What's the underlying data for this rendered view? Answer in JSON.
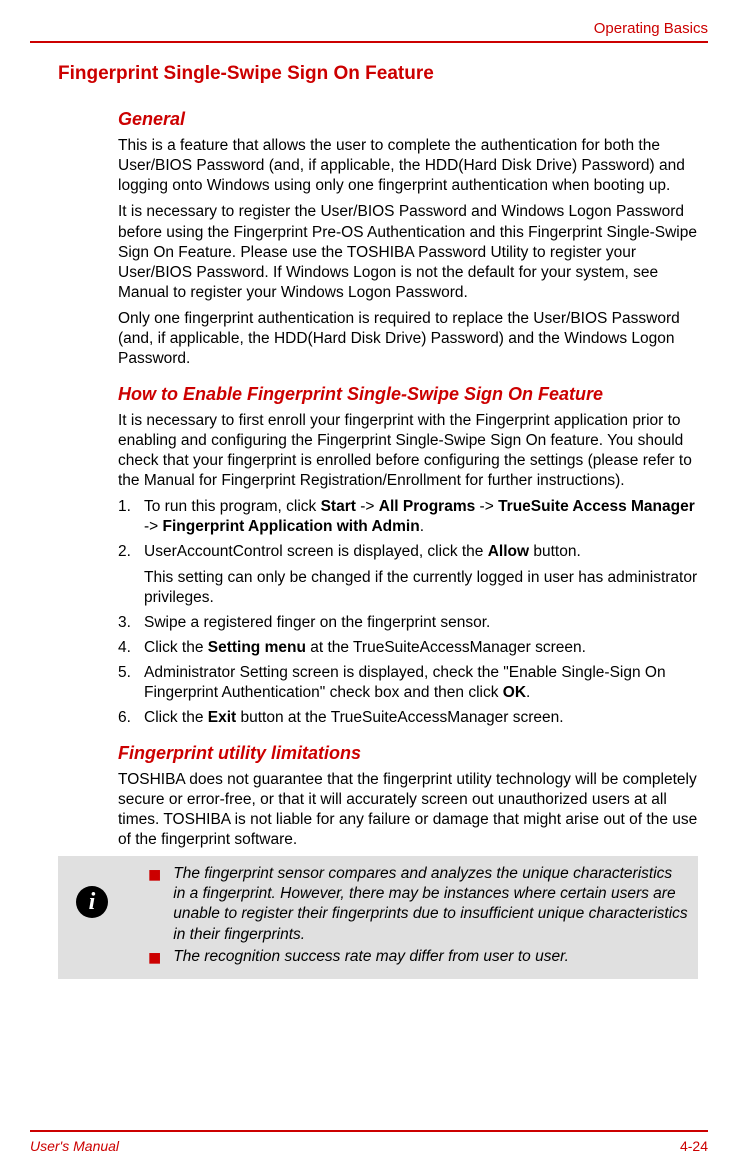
{
  "header": {
    "section_title": "Operating Basics"
  },
  "main_heading": "Fingerprint Single-Swipe Sign On Feature",
  "sections": {
    "general": {
      "heading": "General",
      "para1": "This is a feature that allows the user to complete the authentication for both the User/BIOS Password (and, if applicable, the HDD(Hard Disk Drive) Password) and logging onto Windows using only one fingerprint authentication when booting up.",
      "para2": "It is necessary to register the User/BIOS Password and Windows Logon Password before using the Fingerprint Pre-OS Authentication and this Fingerprint Single-Swipe Sign On Feature. Please use the TOSHIBA Password Utility to register your User/BIOS Password. If Windows Logon is not the default for your system, see Manual to register your Windows Logon Password.",
      "para3": "Only one fingerprint authentication is required to replace the User/BIOS Password (and, if applicable, the HDD(Hard Disk Drive) Password) and the Windows Logon Password."
    },
    "howto": {
      "heading": "How to Enable Fingerprint Single-Swipe Sign On Feature",
      "intro": "It is necessary to first enroll your fingerprint with the Fingerprint application prior to enabling and configuring the Fingerprint Single-Swipe Sign On feature. You should check that your fingerprint is enrolled before configuring the settings (please refer to the Manual for Fingerprint Registration/Enrollment for further instructions).",
      "steps": {
        "s1_pre": "To run this program, click ",
        "s1_b1": "Start",
        "s1_m1": " -> ",
        "s1_b2": "All Programs",
        "s1_m2": " -> ",
        "s1_b3": "TrueSuite Access Manager",
        "s1_m3": " -> ",
        "s1_b4": "Fingerprint Application with Admin",
        "s1_post": ".",
        "s2_pre": "UserAccountControl screen is displayed, click the ",
        "s2_b1": "Allow",
        "s2_post": " button.",
        "s2_sub": "This setting can only be changed if the currently logged in user has administrator privileges.",
        "s3": "Swipe a registered finger on the fingerprint sensor.",
        "s4_pre": "Click the ",
        "s4_b1": "Setting menu",
        "s4_post": " at the TrueSuiteAccessManager screen.",
        "s5_pre": "Administrator Setting screen is displayed, check the \"Enable Single-Sign On Fingerprint Authentication\" check box and then click ",
        "s5_b1": "OK",
        "s5_post": ".",
        "s6_pre": "Click the ",
        "s6_b1": "Exit",
        "s6_post": " button at the TrueSuiteAccessManager screen."
      }
    },
    "limitations": {
      "heading": "Fingerprint utility limitations",
      "para": "TOSHIBA does not guarantee that the fingerprint utility technology will be completely secure or error-free, or that it will accurately screen out unauthorized users at all times. TOSHIBA is not liable for any failure or damage that might arise out of the use of the fingerprint software."
    }
  },
  "infobox": {
    "item1": "The fingerprint sensor compares and analyzes the unique characteristics in a fingerprint. However, there may be instances where certain users are unable to register their fingerprints due to insufficient unique characteristics in their fingerprints.",
    "item2": "The recognition success rate may differ from user to user."
  },
  "footer": {
    "left": "User's Manual",
    "right": "4-24"
  }
}
